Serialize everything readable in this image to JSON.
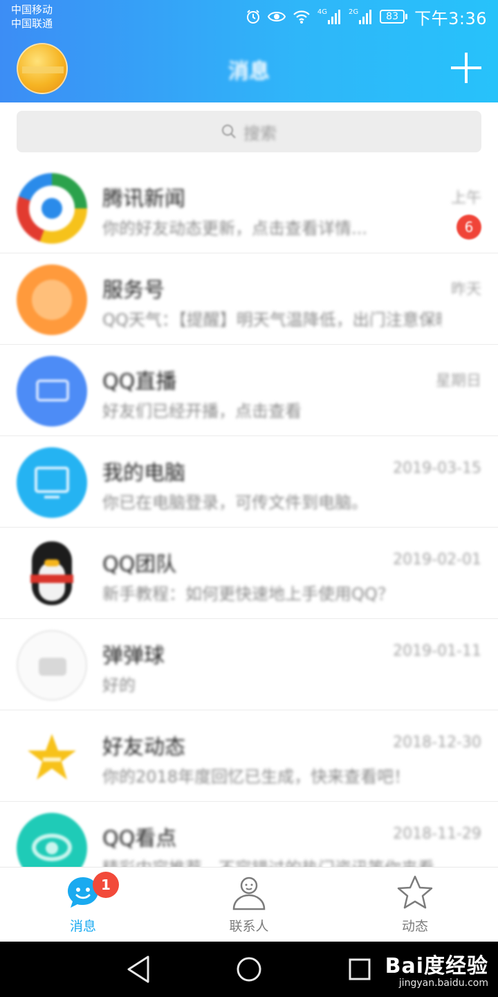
{
  "status_bar": {
    "carrier1": "中国移动",
    "carrier2": "中国联通",
    "net1": "4G",
    "net2": "2G",
    "battery": "83",
    "time": "下午3:36"
  },
  "header": {
    "title": "消息"
  },
  "search": {
    "placeholder": "搜索"
  },
  "conversations": [
    {
      "name": "腾讯新闻",
      "message": "你的好友动态更新，点击查看详情...",
      "time": "上午",
      "unread": "6",
      "avatar": "tencent-news"
    },
    {
      "name": "服务号",
      "message": "QQ天气：【提醒】明天气温降低，出门注意保暖~",
      "time": "昨天",
      "unread": "",
      "avatar": "service"
    },
    {
      "name": "QQ直播",
      "message": "好友们已经开播，点击查看",
      "time": "星期日",
      "unread": "",
      "avatar": "live"
    },
    {
      "name": "我的电脑",
      "message": "你已在电脑登录，可传文件到电脑。",
      "time": "2019-03-15",
      "unread": "",
      "avatar": "computer"
    },
    {
      "name": "QQ团队",
      "message": "新手教程：如何更快速地上手使用QQ？",
      "time": "2019-02-01",
      "unread": "",
      "avatar": "penguin"
    },
    {
      "name": "弹弹球",
      "message": "好的",
      "time": "2019-01-11",
      "unread": "",
      "avatar": "plain"
    },
    {
      "name": "好友动态",
      "message": "你的2018年度回忆已生成，快来查看吧！",
      "time": "2018-12-30",
      "unread": "",
      "avatar": "star"
    },
    {
      "name": "QQ看点",
      "message": "精彩内容推荐，不容错过的热门资讯等你来看",
      "time": "2018-11-29",
      "unread": "",
      "avatar": "kandian"
    }
  ],
  "tabs": [
    {
      "label": "消息",
      "badge": "1"
    },
    {
      "label": "联系人"
    },
    {
      "label": "动态"
    }
  ],
  "watermark": {
    "brand": "Bai度经验",
    "url": "jingyan.baidu.com"
  },
  "colors": {
    "header_gradient_start": "#3c8df5",
    "header_gradient_end": "#27c2fa",
    "active_tab": "#1aaaf0",
    "badge": "#f24a3a"
  }
}
